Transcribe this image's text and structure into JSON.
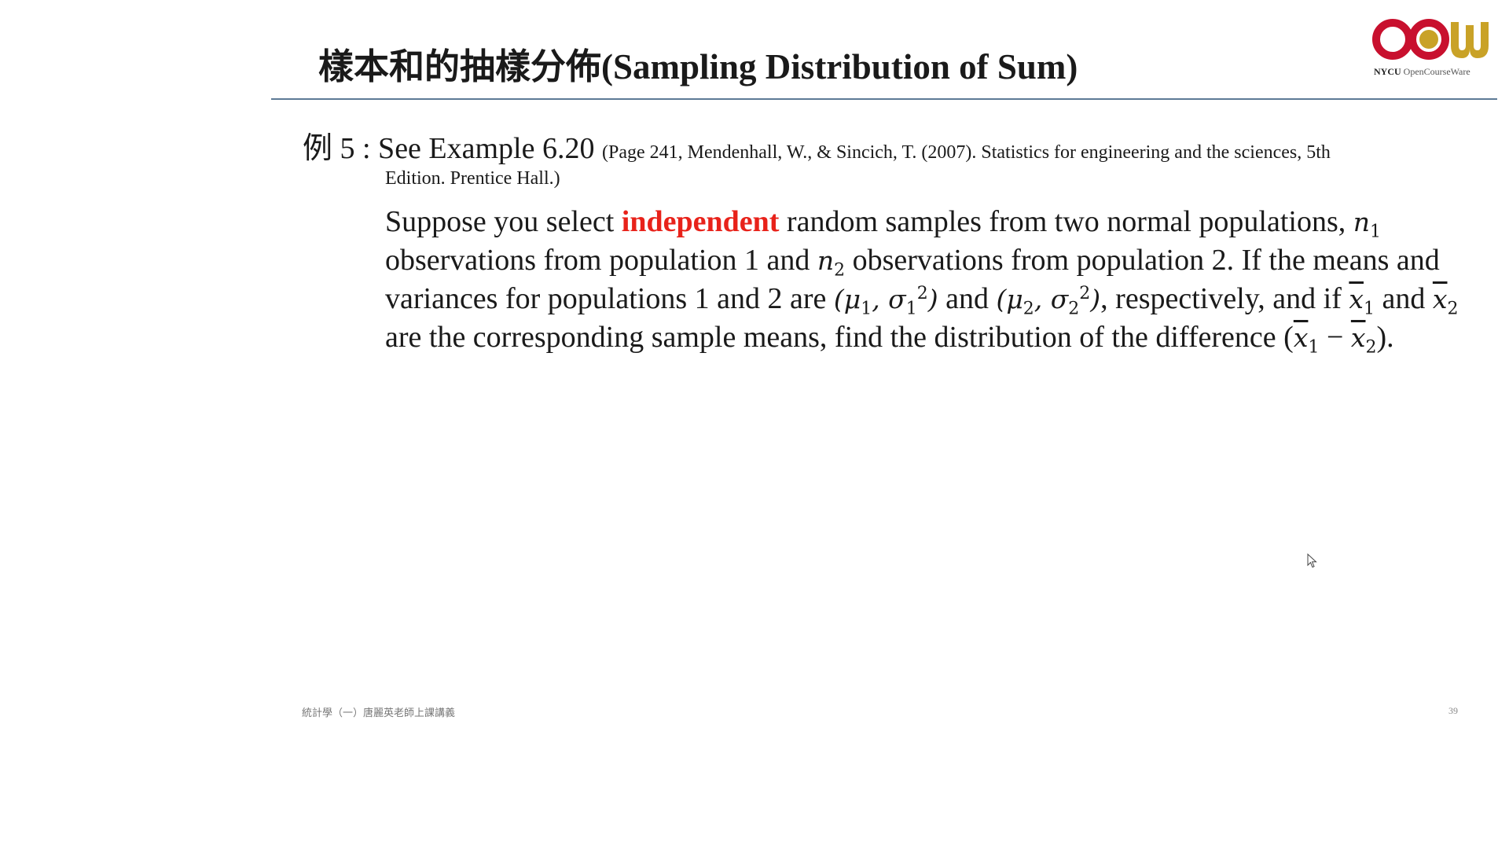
{
  "slide": {
    "title": "樣本和的抽樣分佈(Sampling Distribution of Sum)",
    "page_number": "39",
    "footer": "統計學（一）唐麗英老師上課講義"
  },
  "logo": {
    "nycu": "NYCU",
    "ocw": "OpenCourseWare",
    "colors": {
      "red": "#c8102e",
      "gold": "#c9a227"
    }
  },
  "example": {
    "label": "例 5 : See Example 6.20",
    "reference_line1": "(Page 241, Mendenhall, W., & Sincich, T. (2007). Statistics for engineering and the sciences, 5th",
    "reference_line2": "Edition. Prentice Hall.)"
  },
  "problem": {
    "t1": "Suppose you select ",
    "highlight": "independent",
    "t2": " random samples from two normal populations, ",
    "t3": " observations from population 1 and ",
    "t4": " observations from population 2. If the means and variances for populations 1 and 2 are ",
    "t5": " and ",
    "t6": ", respectively, and if ",
    "t7": " and ",
    "t8": " are the corresponding sample means, find the distribution of the difference (",
    "t9": " − ",
    "t10": ").",
    "n": "n",
    "mu": "μ",
    "sigma": "σ",
    "x": "x",
    "sub1": "1",
    "sub2": "2",
    "sup2": "2",
    "lparen": "(",
    "rparen": ")",
    "comma": ", "
  },
  "colors": {
    "accent": "#e8221a",
    "rule": "#5d7a96"
  }
}
